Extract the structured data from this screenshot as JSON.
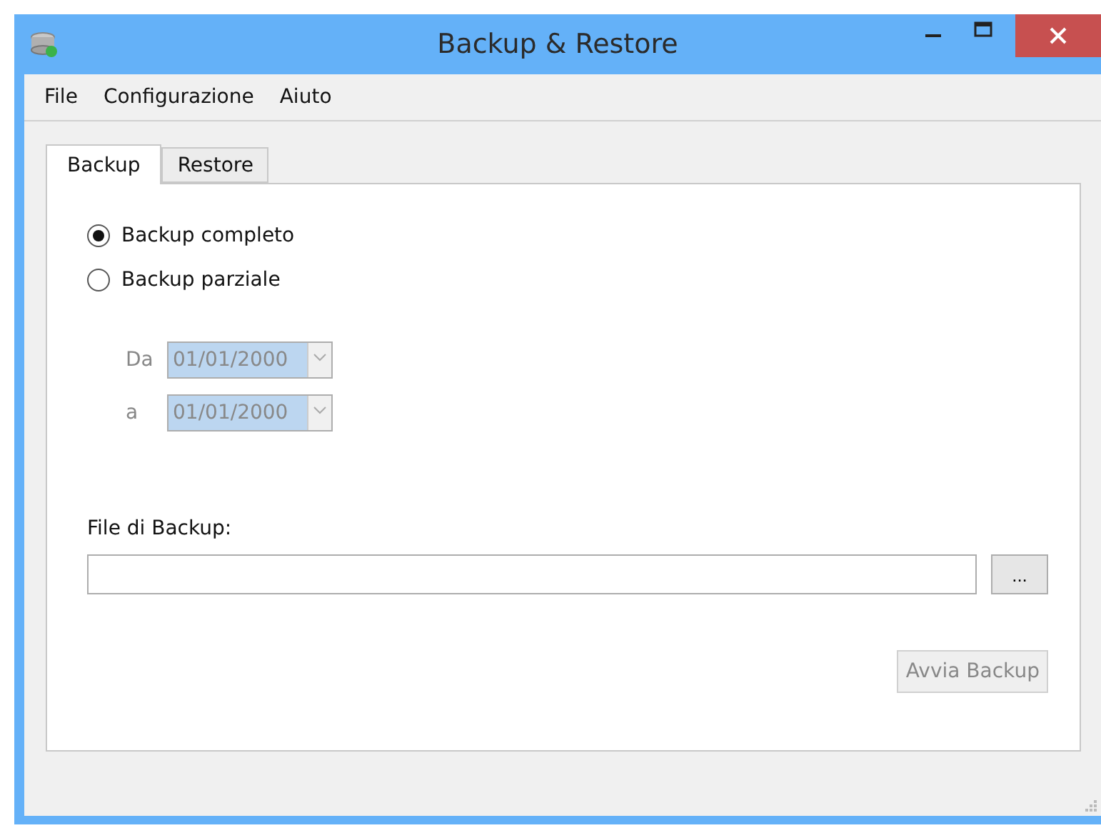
{
  "window": {
    "title": "Backup & Restore"
  },
  "menu": [
    "File",
    "Configurazione",
    "Aiuto"
  ],
  "tabs": [
    {
      "label": "Backup",
      "selected": true
    },
    {
      "label": "Restore",
      "selected": false
    }
  ],
  "options": [
    {
      "label": "Backup completo",
      "selected": true
    },
    {
      "label": "Backup parziale",
      "selected": false
    }
  ],
  "dates": [
    {
      "label": "Da",
      "value": "01/01/2000",
      "disabled": true
    },
    {
      "label": "a",
      "value": "01/01/2000",
      "disabled": true
    }
  ],
  "file": {
    "label": "File di Backup:",
    "browse": "..."
  },
  "start_button": {
    "label": "Avvia Backup",
    "disabled": true
  }
}
